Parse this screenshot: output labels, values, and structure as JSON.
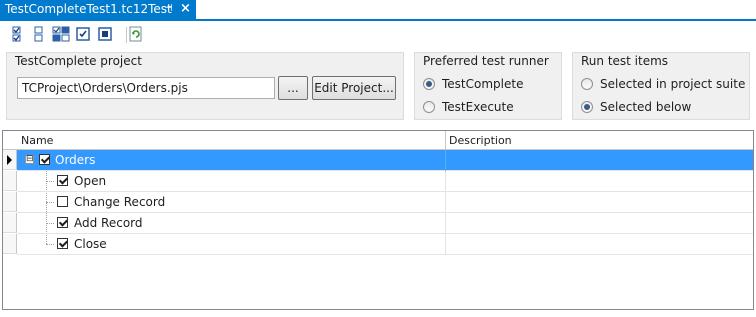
{
  "tab": {
    "title": "TestCompleteTest1.tc12Test",
    "pin": "⊣",
    "close": "×"
  },
  "toolbar": {
    "buttons": [
      {
        "icon": "check-all-icon"
      },
      {
        "icon": "uncheck-all-icon"
      },
      {
        "icon": "invert-check-icon"
      },
      {
        "icon": "check-selected-icon"
      },
      {
        "icon": "uncheck-selected-icon"
      },
      {
        "icon": "refresh-icon"
      }
    ]
  },
  "project": {
    "title": "TestComplete project",
    "path": "TCProject\\Orders\\Orders.pjs",
    "browse_label": "...",
    "edit_label": "Edit Project..."
  },
  "runner": {
    "title": "Preferred test runner",
    "options": [
      {
        "label": "TestComplete",
        "checked": true
      },
      {
        "label": "TestExecute",
        "checked": false
      }
    ]
  },
  "run_items": {
    "title": "Run test items",
    "options": [
      {
        "label": "Selected in project suite",
        "checked": false
      },
      {
        "label": "Selected below",
        "checked": true
      }
    ]
  },
  "grid": {
    "columns": {
      "name": "Name",
      "description": "Description"
    },
    "rows": [
      {
        "label": "Orders",
        "checked": true,
        "expander": "⊟",
        "selected": true
      },
      {
        "label": "Open",
        "checked": true
      },
      {
        "label": "Change Record",
        "checked": false
      },
      {
        "label": "Add Record",
        "checked": true
      },
      {
        "label": "Close",
        "checked": true
      }
    ]
  },
  "colors": {
    "accent": "#007acc",
    "selection": "#3399ff",
    "group_bg": "#f0f0f0"
  }
}
